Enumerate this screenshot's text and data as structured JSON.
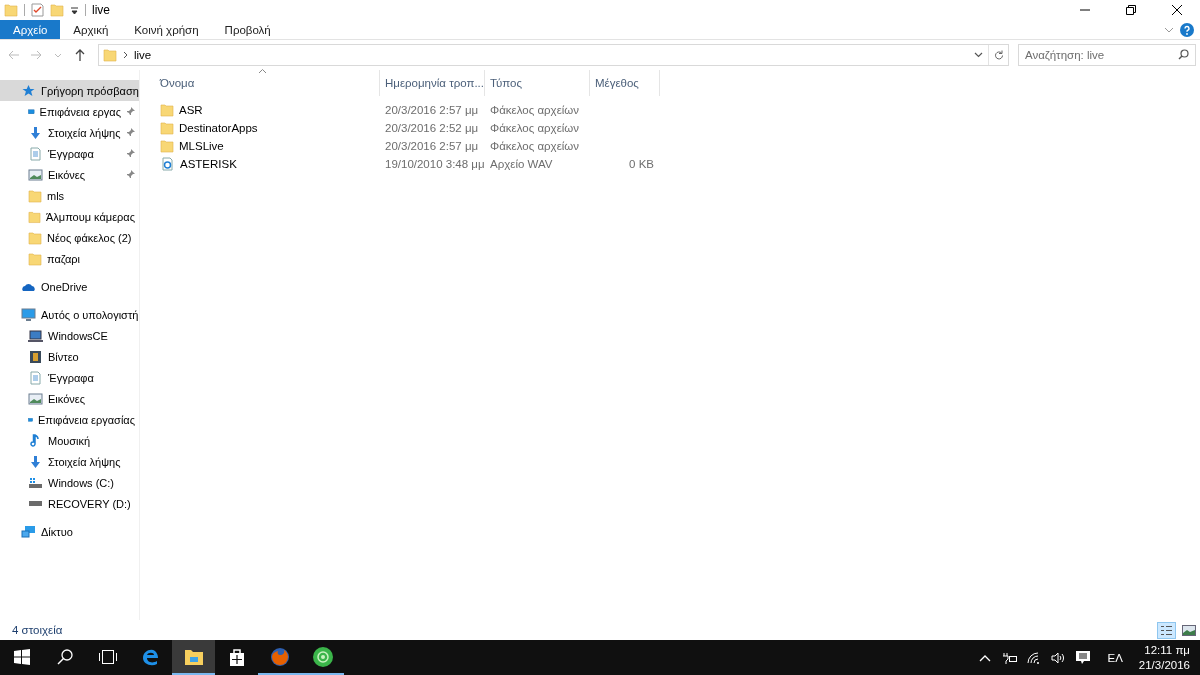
{
  "window": {
    "title": "live"
  },
  "ribbon_tabs": [
    {
      "label": "Αρχείο",
      "selected": true
    },
    {
      "label": "Αρχική",
      "selected": false
    },
    {
      "label": "Κοινή χρήση",
      "selected": false
    },
    {
      "label": "Προβολή",
      "selected": false
    }
  ],
  "address": {
    "path": "live"
  },
  "search": {
    "placeholder": "Αναζήτηση: live"
  },
  "sidebar": [
    {
      "label": "Γρήγορη πρόσβαση",
      "kind": "star",
      "selected": true,
      "children": [
        {
          "label": "Επιφάνεια εργας",
          "kind": "desktop",
          "pinned": true
        },
        {
          "label": "Στοιχεία λήψης",
          "kind": "download",
          "pinned": true
        },
        {
          "label": "Έγγραφα",
          "kind": "document",
          "pinned": true
        },
        {
          "label": "Εικόνες",
          "kind": "pictures",
          "pinned": true
        },
        {
          "label": "mls",
          "kind": "folder",
          "pinned": false
        },
        {
          "label": "Άλμπουμ κάμερας",
          "kind": "folder",
          "pinned": false
        },
        {
          "label": "Νέος φάκελος (2)",
          "kind": "folder",
          "pinned": false
        },
        {
          "label": "παζαρι",
          "kind": "folder",
          "pinned": false
        }
      ]
    },
    {
      "label": "OneDrive",
      "kind": "cloud",
      "selected": false
    },
    {
      "label": "Αυτός ο υπολογιστή",
      "kind": "computer",
      "selected": false,
      "children": [
        {
          "label": "WindowsCE",
          "kind": "laptop",
          "pinned": false
        },
        {
          "label": "Βίντεο",
          "kind": "video",
          "pinned": false
        },
        {
          "label": "Έγγραφα",
          "kind": "document",
          "pinned": false
        },
        {
          "label": "Εικόνες",
          "kind": "pictures",
          "pinned": false
        },
        {
          "label": "Επιφάνεια εργασίας",
          "kind": "desktop",
          "pinned": false
        },
        {
          "label": "Μουσική",
          "kind": "music",
          "pinned": false
        },
        {
          "label": "Στοιχεία λήψης",
          "kind": "download",
          "pinned": false
        },
        {
          "label": "Windows (C:)",
          "kind": "windrive",
          "pinned": false
        },
        {
          "label": "RECOVERY (D:)",
          "kind": "drive",
          "pinned": false
        }
      ]
    },
    {
      "label": "Δίκτυο",
      "kind": "network",
      "selected": false
    }
  ],
  "columns": [
    "Όνομα",
    "Ημερομηνία τροπ...",
    "Τύπος",
    "Μέγεθος"
  ],
  "rows": [
    {
      "kind": "folder",
      "name": "ASR",
      "date": "20/3/2016 2:57 μμ",
      "type": "Φάκελος αρχείων"
    },
    {
      "kind": "folder",
      "name": "DestinatorApps",
      "date": "20/3/2016 2:52 μμ",
      "type": "Φάκελος αρχείων"
    },
    {
      "kind": "folder",
      "name": "MLSLive",
      "date": "20/3/2016 2:57 μμ",
      "type": "Φάκελος αρχείων"
    },
    {
      "kind": "audio",
      "name": "ASTERISK",
      "date": "19/10/2010 3:48 μμ",
      "type": "Αρχείο WAV",
      "size": "0 KB"
    }
  ],
  "status_bar": {
    "count": "4 στοιχεία",
    "views": [
      {
        "kind": "details",
        "selected": true
      },
      {
        "kind": "thumbnails",
        "selected": false
      }
    ]
  },
  "taskbar": {
    "apps": [
      {
        "kind": "edge",
        "running": false,
        "selected": false
      },
      {
        "kind": "explorer",
        "running": true,
        "selected": true
      },
      {
        "kind": "store",
        "running": false,
        "selected": false
      },
      {
        "kind": "firefox",
        "running": true,
        "selected": false
      },
      {
        "kind": "green",
        "running": true,
        "selected": false
      }
    ],
    "language": "ΕΛ",
    "time": "12:11 πμ",
    "date": "21/3/2016"
  }
}
